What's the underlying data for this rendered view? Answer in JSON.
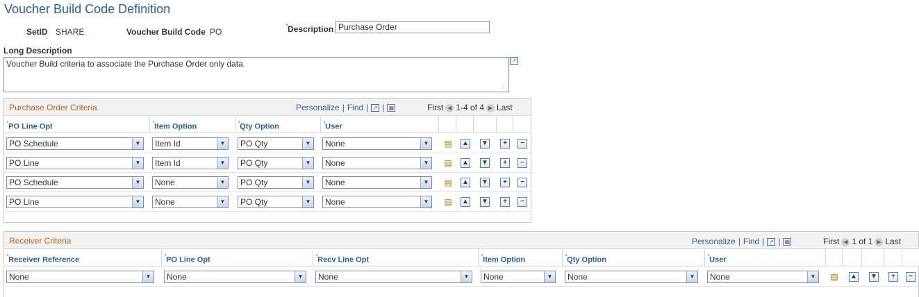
{
  "page": {
    "title": "Voucher Build Code Definition",
    "setid_label": "SetID",
    "setid_value": "SHARE",
    "vbc_label": "Voucher Build Code",
    "vbc_value": "PO",
    "description_label": "Description",
    "description_value": "Purchase Order",
    "long_description_label": "Long Description",
    "long_description_value": "Voucher Build criteria to associate the Purchase Order only data"
  },
  "po_grid": {
    "title": "Purchase Order Criteria",
    "personalize": "Personalize",
    "find": "Find",
    "first": "First",
    "range": "1-4 of 4",
    "last": "Last",
    "columns": [
      "PO Line Opt",
      "Item Option",
      "Qty Option",
      "User"
    ],
    "rows": [
      {
        "po_line_opt": "PO Schedule",
        "item_option": "Item Id",
        "qty_option": "PO Qty",
        "user": "None"
      },
      {
        "po_line_opt": "PO Line",
        "item_option": "Item Id",
        "qty_option": "PO Qty",
        "user": "None"
      },
      {
        "po_line_opt": "PO Schedule",
        "item_option": "None",
        "qty_option": "PO Qty",
        "user": "None"
      },
      {
        "po_line_opt": "PO Line",
        "item_option": "None",
        "qty_option": "PO Qty",
        "user": "None"
      }
    ]
  },
  "recv_grid": {
    "title": "Receiver Criteria",
    "personalize": "Personalize",
    "find": "Find",
    "first": "First",
    "range": "1 of 1",
    "last": "Last",
    "columns": [
      "Receiver Reference",
      "PO Line Opt",
      "Recv Line Opt",
      "Item Option",
      "Qty Option",
      "User"
    ],
    "rows": [
      {
        "receiver_reference": "None",
        "po_line_opt": "None",
        "recv_line_opt": "None",
        "item_option": "None",
        "qty_option": "None",
        "user": "None"
      }
    ]
  },
  "icons": {
    "required_marker": "'",
    "expand": "expand-icon",
    "view_all": "view-all-icon",
    "grid_download": "grid-download-icon",
    "row_detail": "row-detail-icon",
    "insert_before": "insert-before-icon",
    "insert_after": "insert-after-icon",
    "add_row": "add-row-icon",
    "delete_row": "delete-row-icon"
  }
}
